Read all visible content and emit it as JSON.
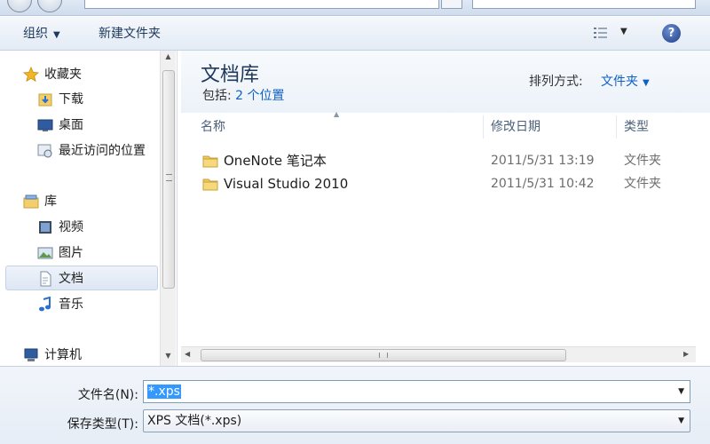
{
  "toolbar": {
    "organize_label": "组织",
    "new_folder_label": "新建文件夹",
    "help_label": "?"
  },
  "nav": {
    "favorites": "收藏夹",
    "downloads": "下载",
    "desktop": "桌面",
    "recent": "最近访问的位置",
    "libraries": "库",
    "videos": "视频",
    "pictures": "图片",
    "documents": "文档",
    "music": "音乐",
    "computer": "计算机"
  },
  "library": {
    "title": "文档库",
    "includes_prefix": "包括:",
    "includes_link": "2 个位置",
    "arrange_label": "排列方式:",
    "arrange_value": "文件夹"
  },
  "columns": {
    "name": "名称",
    "date": "修改日期",
    "type": "类型"
  },
  "files": [
    {
      "name": "OneNote 笔记本",
      "date": "2011/5/31 13:19",
      "type": "文件夹"
    },
    {
      "name": "Visual Studio 2010",
      "date": "2011/5/31 10:42",
      "type": "文件夹"
    }
  ],
  "form": {
    "filename_label": "文件名(N):",
    "filename_value": "*.xps",
    "filetype_label": "保存类型(T):",
    "filetype_value": "XPS 文档(*.xps)"
  }
}
